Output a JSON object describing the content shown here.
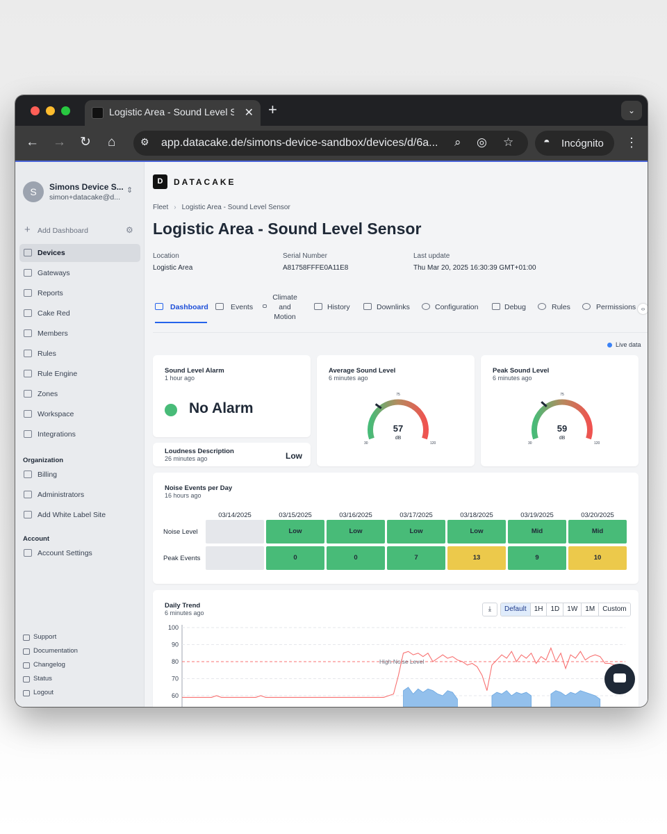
{
  "browser": {
    "tab_title": "Logistic Area - Sound Level Sensor",
    "url": "app.datacake.de/simons-device-sandbox/devices/d/6a...",
    "incognito_label": "Incógnito",
    "accent_color": "#4a64d8"
  },
  "sidebar": {
    "org_name": "Simons Device S...",
    "org_email": "simon+datacake@d...",
    "org_initial": "S",
    "add_dashboard": "Add Dashboard",
    "items": [
      {
        "label": "Devices",
        "icon": "devices-icon",
        "active": true
      },
      {
        "label": "Gateways",
        "icon": "gateway-icon"
      },
      {
        "label": "Reports",
        "icon": "report-icon"
      },
      {
        "label": "Cake Red",
        "icon": "cake-red-icon"
      },
      {
        "label": "Members",
        "icon": "members-icon"
      },
      {
        "label": "Rules",
        "icon": "rules-icon"
      },
      {
        "label": "Rule Engine",
        "icon": "rule-engine-icon"
      },
      {
        "label": "Zones",
        "icon": "map-icon"
      },
      {
        "label": "Workspace",
        "icon": "home-icon"
      },
      {
        "label": "Integrations",
        "icon": "integrations-icon"
      }
    ],
    "organization_label": "Organization",
    "org_items": [
      {
        "label": "Billing",
        "icon": "billing-icon"
      },
      {
        "label": "Administrators",
        "icon": "admins-icon"
      },
      {
        "label": "Add White Label Site",
        "icon": "plus-icon"
      }
    ],
    "account_label": "Account",
    "account_items": [
      {
        "label": "Account Settings",
        "icon": "gear-icon"
      }
    ],
    "footer": [
      "Support",
      "Documentation",
      "Changelog",
      "Status",
      "Logout"
    ]
  },
  "header": {
    "brand": "DATACAKE",
    "breadcrumb": [
      "Fleet",
      "Logistic Area - Sound Level Sensor"
    ],
    "title": "Logistic Area - Sound Level Sensor"
  },
  "meta": {
    "location_label": "Location",
    "location_value": "Logistic Area",
    "serial_label": "Serial Number",
    "serial_value": "A81758FFFE0A11E8",
    "update_label": "Last update",
    "update_value": "Thu Mar 20, 2025 16:30:39 GMT+01:00"
  },
  "tabs": [
    {
      "label": "Dashboard",
      "active": true
    },
    {
      "label": "Events"
    },
    {
      "label": "Climate and Motion"
    },
    {
      "label": "History"
    },
    {
      "label": "Downlinks"
    },
    {
      "label": "Configuration"
    },
    {
      "label": "Debug"
    },
    {
      "label": "Rules"
    },
    {
      "label": "Permissions"
    }
  ],
  "live_data": "Live data",
  "widgets": {
    "alarm": {
      "title": "Sound Level Alarm",
      "sub": "1 hour ago",
      "value": "No Alarm"
    },
    "loudness": {
      "title": "Loudness Description",
      "sub": "26 minutes ago",
      "value": "Low"
    },
    "avg": {
      "title": "Average Sound Level",
      "sub": "6 minutes ago",
      "value": "57",
      "unit": "dB",
      "min": "30",
      "mid": "75",
      "max": "120"
    },
    "peak": {
      "title": "Peak Sound Level",
      "sub": "6 minutes ago",
      "value": "59",
      "unit": "dB",
      "min": "30",
      "mid": "75",
      "max": "120"
    }
  },
  "noise_events": {
    "title": "Noise Events per Day",
    "sub": "16 hours ago",
    "dates": [
      "03/14/2025",
      "03/15/2025",
      "03/16/2025",
      "03/17/2025",
      "03/18/2025",
      "03/19/2025",
      "03/20/2025"
    ],
    "rows": [
      {
        "label": "Noise Level",
        "cells": [
          "",
          "Low",
          "Low",
          "Low",
          "Low",
          "Mid",
          "Mid"
        ]
      },
      {
        "label": "Peak Events",
        "cells": [
          "",
          "0",
          "0",
          "7",
          "13",
          "9",
          "10"
        ]
      }
    ],
    "colors": {
      "empty": "#e5e7eb",
      "ok": "#48bb78",
      "warn": "#ecc94b"
    }
  },
  "trend": {
    "title": "Daily Trend",
    "sub": "6 minutes ago",
    "ranges": [
      "Default",
      "1H",
      "1D",
      "1W",
      "1M",
      "Custom"
    ],
    "threshold_label": "High Noise Level"
  },
  "chart_data": {
    "type": "line",
    "yticks": [
      "100",
      "90",
      "80",
      "70",
      "60"
    ],
    "ylim": [
      55,
      100
    ],
    "threshold": 80,
    "series": [
      {
        "values": [
          59,
          59,
          59,
          59,
          59,
          59,
          59,
          60,
          59,
          59,
          59,
          59,
          59,
          59,
          59,
          59,
          60,
          59,
          59,
          59,
          59,
          59,
          59,
          59,
          59,
          59,
          59,
          59,
          59,
          59,
          59,
          59,
          59,
          59,
          59,
          59,
          59,
          59,
          59,
          59,
          59,
          59,
          60,
          61,
          72,
          85,
          86,
          84,
          85,
          83,
          85,
          80,
          82,
          84,
          82,
          83,
          81,
          80,
          78,
          79,
          77,
          72,
          63,
          78,
          81,
          84,
          82,
          86,
          80,
          84,
          82,
          85,
          79,
          83,
          81,
          88,
          80,
          85,
          76,
          84,
          82,
          86,
          81,
          83,
          84,
          83,
          79,
          79,
          78,
          77
        ]
      },
      {
        "values": [
          null,
          null,
          null,
          null,
          null,
          null,
          null,
          null,
          null,
          null,
          null,
          null,
          null,
          null,
          null,
          null,
          null,
          null,
          null,
          null,
          null,
          null,
          null,
          null,
          null,
          null,
          null,
          null,
          null,
          null,
          null,
          null,
          null,
          null,
          null,
          null,
          null,
          null,
          null,
          null,
          null,
          null,
          null,
          null,
          null,
          63,
          65,
          61,
          64,
          62,
          64,
          63,
          61,
          60,
          63,
          62,
          58,
          null,
          null,
          null,
          null,
          null,
          null,
          60,
          62,
          61,
          63,
          60,
          62,
          61,
          62,
          60,
          null,
          null,
          null,
          61,
          63,
          62,
          60,
          62,
          61,
          63,
          62,
          61,
          60,
          58,
          null,
          null,
          null,
          null
        ]
      }
    ]
  }
}
